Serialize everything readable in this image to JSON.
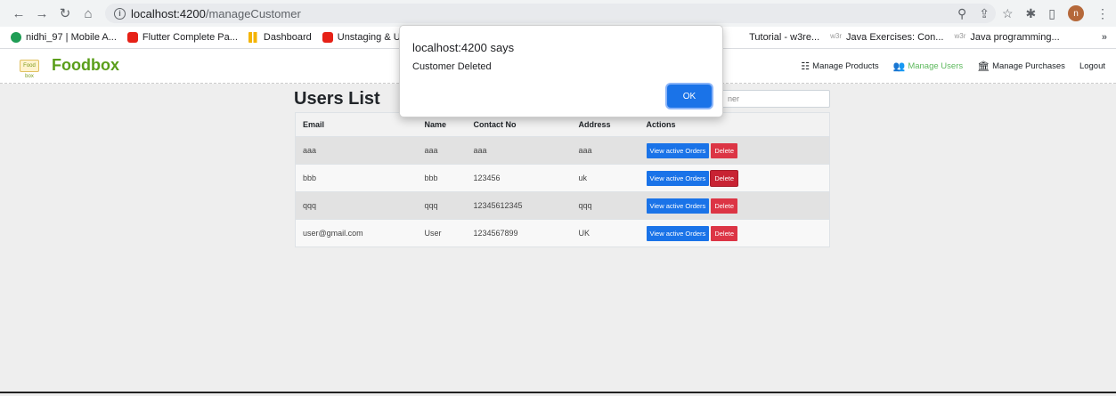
{
  "browser": {
    "url_host": "localhost:4200",
    "url_path": "/manageCustomer",
    "avatar_letter": "n",
    "bookmarks": [
      {
        "label": "nidhi_97 | Mobile A...",
        "icon": "green"
      },
      {
        "label": "Flutter Complete Pa...",
        "icon": "red"
      },
      {
        "label": "Dashboard",
        "icon": "yellow"
      },
      {
        "label": "Unstaging & Unmo",
        "icon": "red"
      }
    ],
    "bookmarks_right": [
      {
        "label": "Tutorial - w3re...",
        "icon": "none"
      },
      {
        "label": "Java Exercises: Con...",
        "icon": "w3"
      },
      {
        "label": "Java programming...",
        "icon": "w3"
      }
    ],
    "more": "»"
  },
  "navbar": {
    "brand": "Foodbox",
    "logo_text": "Food box",
    "links": [
      {
        "label": "Manage Products",
        "icon": "☷"
      },
      {
        "label": "Manage Users",
        "icon": "👥"
      },
      {
        "label": "Manage Purchases",
        "icon": "🏛"
      },
      {
        "label": "Logout",
        "icon": ""
      }
    ]
  },
  "main": {
    "title": "Users List",
    "search_placeholder": "ner",
    "columns": [
      "Email",
      "Name",
      "Contact No",
      "Address",
      "Actions"
    ],
    "rows": [
      {
        "email": "aaa",
        "name": "aaa",
        "contact": "aaa",
        "address": "aaa"
      },
      {
        "email": "bbb",
        "name": "bbb",
        "contact": "123456",
        "address": "uk"
      },
      {
        "email": "qqq",
        "name": "qqq",
        "contact": "12345612345",
        "address": "qqq"
      },
      {
        "email": "user@gmail.com",
        "name": "User",
        "contact": "1234567899",
        "address": "UK"
      }
    ],
    "view_label": "View active Orders",
    "delete_label": "Delete"
  },
  "dialog": {
    "title": "localhost:4200 says",
    "message": "Customer Deleted",
    "ok_label": "OK"
  },
  "colors": {
    "brand": "#5a9e1a",
    "primary": "#1a73e8",
    "danger": "#dc3545"
  }
}
